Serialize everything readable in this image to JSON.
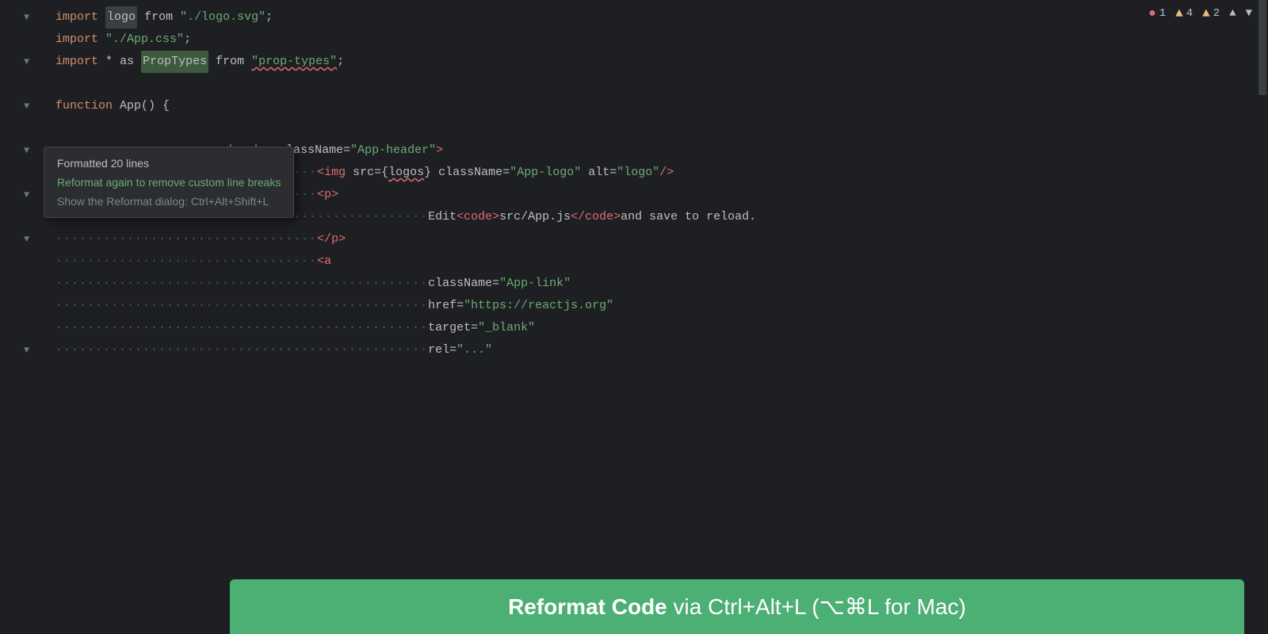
{
  "topbar": {
    "error_count": "1",
    "warn_count1": "4",
    "warn_count2": "2"
  },
  "tooltip": {
    "line1": "Formatted 20 lines",
    "line2": "Reformat again to remove custom line breaks",
    "line3": "Show the Reformat dialog: Ctrl+Alt+Shift+L"
  },
  "banner": {
    "bold_text": "Reformat Code",
    "normal_text": " via Ctrl+Alt+L (⌥⌘L for Mac)"
  },
  "code": {
    "line1": "import logo from \"./logo.svg\";",
    "line2": "import \"./App.css\";",
    "line3": "import * as PropTypes from \"prop-types\";",
    "line4": "function App() {",
    "line5": "            <header className=\"App-header\">",
    "line6": "                <img src={logos} className=\"App-logo\" alt=\"logo\"/>",
    "line7": "                <p>",
    "line8": "                    Edit <code>src/App.js</code> and save to reload.",
    "line9": "                </p>",
    "line10": "                <a",
    "line11": "                    className=\"App-link\"",
    "line12": "                    href=\"https://reactjs.org\"",
    "line13": "                    target=\"_blank\""
  }
}
